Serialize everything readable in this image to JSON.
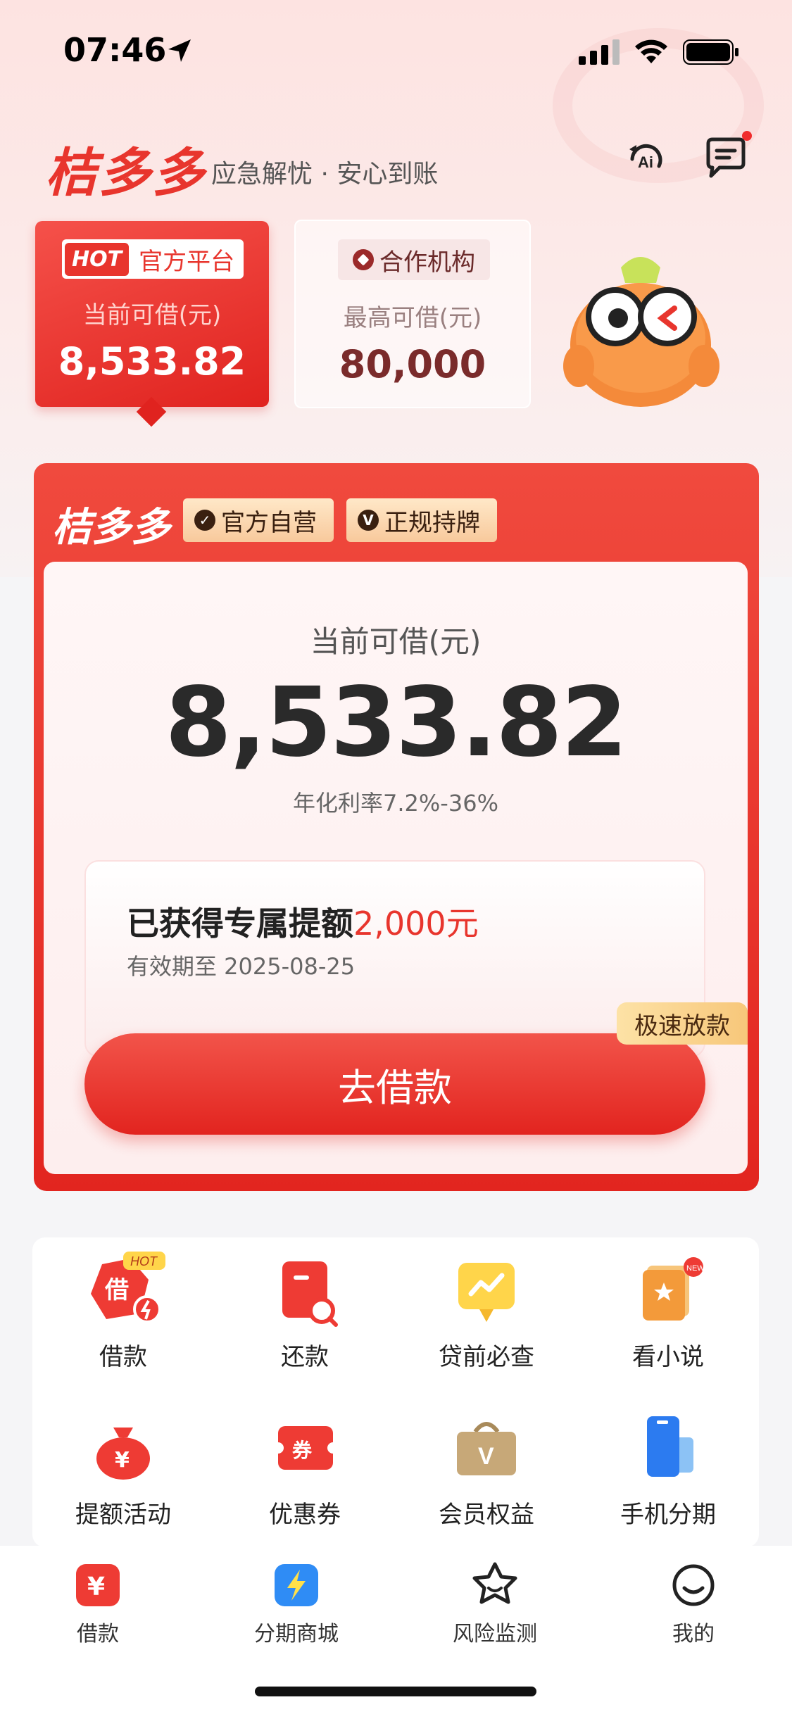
{
  "status_bar": {
    "time": "07:46"
  },
  "header": {
    "brand": "桔多多",
    "slogan": "应急解忧 · 安心到账"
  },
  "platform_cards": {
    "official": {
      "hot_badge": "HOT",
      "tag": "官方平台",
      "label": "当前可借(元)",
      "value": "8,533.82"
    },
    "partner": {
      "tag": "合作机构",
      "label": "最高可借(元)",
      "value": "80,000"
    }
  },
  "loan_panel": {
    "brand": "桔多多",
    "badges": [
      "官方自营",
      "正规持牌"
    ],
    "amount_label": "当前可借(元)",
    "amount_value": "8,533.82",
    "rate": "年化利率7.2%-36%",
    "quota_prefix": "已获得专属提额",
    "quota_amount": "2,000元",
    "quota_valid": "有效期至 2025-08-25",
    "fast_tag": "极速放款",
    "button_label": "去借款"
  },
  "services": [
    {
      "label": "借款",
      "icon": "borrow-icon",
      "badge": "HOT"
    },
    {
      "label": "还款",
      "icon": "repay-icon"
    },
    {
      "label": "贷前必查",
      "icon": "precheck-icon"
    },
    {
      "label": "看小说",
      "icon": "novel-icon",
      "badge": "NEW"
    },
    {
      "label": "提额活动",
      "icon": "money-bag-icon"
    },
    {
      "label": "优惠券",
      "icon": "coupon-icon"
    },
    {
      "label": "会员权益",
      "icon": "vip-bag-icon"
    },
    {
      "label": "手机分期",
      "icon": "phone-icon"
    }
  ],
  "tabbar": [
    {
      "label": "借款",
      "icon": "yuan-icon"
    },
    {
      "label": "分期商城",
      "icon": "lightning-icon"
    },
    {
      "label": "风险监测",
      "icon": "star-face-icon"
    },
    {
      "label": "我的",
      "icon": "smile-icon"
    }
  ],
  "colors": {
    "brand_red": "#e8352d",
    "gold": "#f8c99c"
  }
}
